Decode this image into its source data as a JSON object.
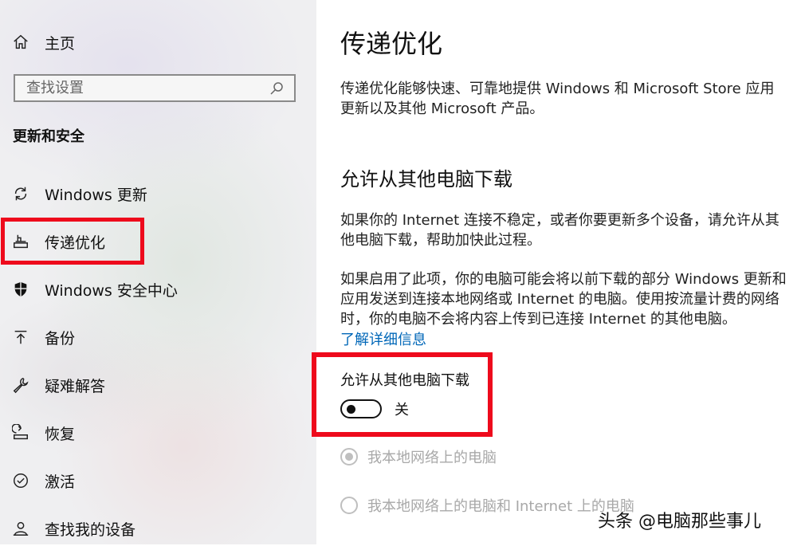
{
  "sidebar": {
    "home_label": "主页",
    "search_placeholder": "查找设置",
    "section_title": "更新和安全",
    "items": [
      {
        "label": "Windows 更新",
        "icon": "refresh-icon"
      },
      {
        "label": "传递优化",
        "icon": "delivery-optimization-icon",
        "selected": true
      },
      {
        "label": "Windows 安全中心",
        "icon": "shield-icon"
      },
      {
        "label": "备份",
        "icon": "backup-arrow-icon"
      },
      {
        "label": "疑难解答",
        "icon": "wrench-icon"
      },
      {
        "label": "恢复",
        "icon": "recovery-icon"
      },
      {
        "label": "激活",
        "icon": "check-circle-icon"
      },
      {
        "label": "查找我的设备",
        "icon": "person-locate-icon"
      }
    ]
  },
  "content": {
    "title": "传递优化",
    "intro": "传递优化能够快速、可靠地提供 Windows 和 Microsoft Store 应用更新以及其他 Microsoft 产品。",
    "subsection_title": "允许从其他电脑下载",
    "para1": "如果你的 Internet 连接不稳定，或者你要更新多个设备，请允许从其他电脑下载，帮助加快此过程。",
    "para2": "如果启用了此项，你的电脑可能会将以前下载的部分 Windows 更新和应用发送到连接本地网络或 Internet 的电脑。使用按流量计费的网络时，你的电脑不会将内容上传到已连接 Internet 的其他电脑。",
    "learn_more": "了解详细信息",
    "toggle": {
      "label": "允许从其他电脑下载",
      "state": "关",
      "on": false
    },
    "radio_options": [
      {
        "label": "我本地网络上的电脑",
        "selected": true,
        "disabled": true
      },
      {
        "label": "我本地网络上的电脑和 Internet 上的电脑",
        "selected": false,
        "disabled": true
      }
    ]
  },
  "watermark": "头条 @电脑那些事儿",
  "colors": {
    "highlight_box": "#ee0a1c",
    "link": "#0067b8",
    "sidebar_bg": "#efeff1",
    "disabled_text": "#a8a8a8"
  }
}
